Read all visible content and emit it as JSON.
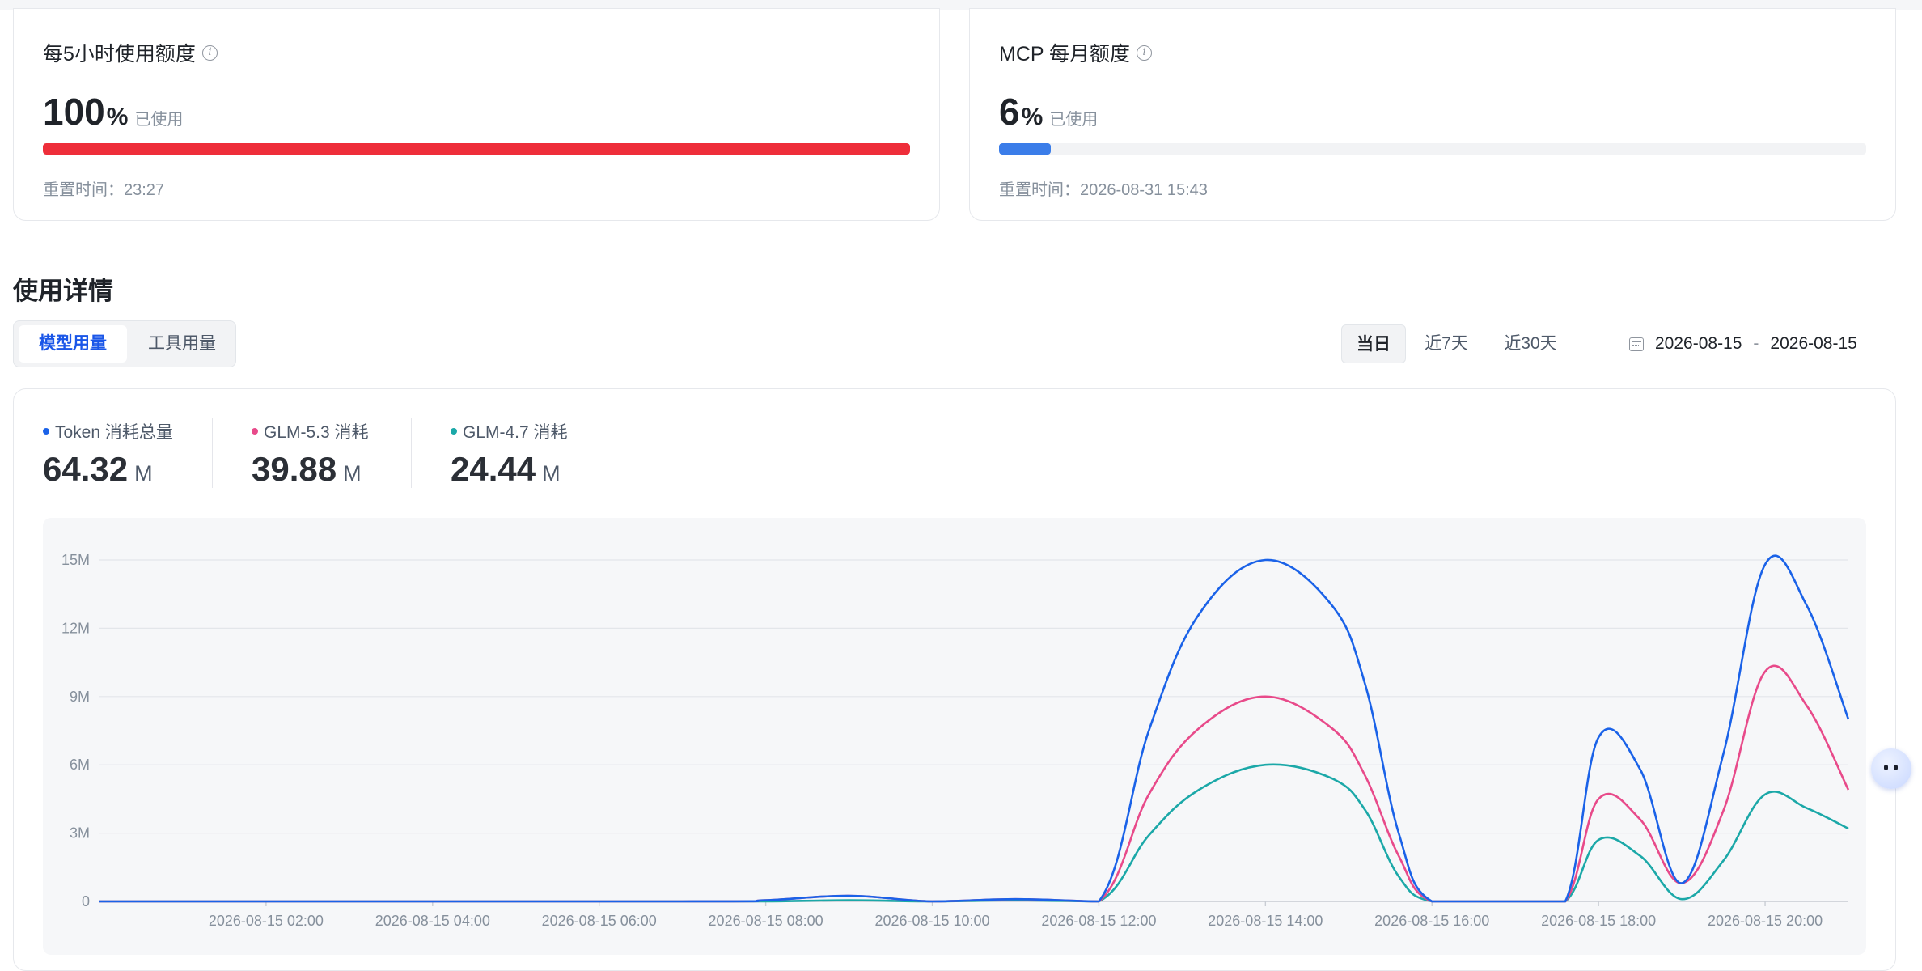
{
  "quota_cards": [
    {
      "title": "每5小时使用额度",
      "value": "100",
      "unit": "%",
      "used_label": "已使用",
      "reset": "重置时间：23:27",
      "percent": 100,
      "color": "#ee2e3a"
    },
    {
      "title": "MCP 每月额度",
      "value": "6",
      "unit": "%",
      "used_label": "已使用",
      "reset": "重置时间：2026-08-31 15:43",
      "percent": 6,
      "color": "#3b7de9"
    }
  ],
  "section_title": "使用详情",
  "tabs": {
    "model": "模型用量",
    "tool": "工具用量"
  },
  "range": {
    "today": "当日",
    "last7": "近7天",
    "last30": "近30天"
  },
  "date_range": {
    "start": "2026-08-15",
    "sep": "-",
    "end": "2026-08-15"
  },
  "stats": [
    {
      "label": "Token 消耗总量",
      "value": "64.32",
      "unit": "M",
      "color": "#1a62e8"
    },
    {
      "label": "GLM-5.3 消耗",
      "value": "39.88",
      "unit": "M",
      "color": "#e84a8a"
    },
    {
      "label": "GLM-4.7 消耗",
      "value": "24.44",
      "unit": "M",
      "color": "#1ba8a8"
    }
  ],
  "chart_data": {
    "type": "line",
    "x_unit": "hours since 2026-08-15 00:00",
    "x_start": 1.0,
    "x_end": 22.0,
    "ylim": [
      0,
      15
    ],
    "y_ticks": [
      {
        "v": 0,
        "label": "0"
      },
      {
        "v": 3,
        "label": "3M"
      },
      {
        "v": 6,
        "label": "6M"
      },
      {
        "v": 9,
        "label": "9M"
      },
      {
        "v": 12,
        "label": "12M"
      },
      {
        "v": 15,
        "label": "15M"
      }
    ],
    "x_ticks": [
      {
        "v": 3,
        "label": "2026-08-15 02:00"
      },
      {
        "v": 5,
        "label": "2026-08-15 04:00"
      },
      {
        "v": 7,
        "label": "2026-08-15 06:00"
      },
      {
        "v": 9,
        "label": "2026-08-15 08:00"
      },
      {
        "v": 11,
        "label": "2026-08-15 10:00"
      },
      {
        "v": 13,
        "label": "2026-08-15 12:00"
      },
      {
        "v": 15,
        "label": "2026-08-15 14:00"
      },
      {
        "v": 17,
        "label": "2026-08-15 16:00"
      },
      {
        "v": 19,
        "label": "2026-08-15 18:00"
      },
      {
        "v": 21,
        "label": "2026-08-15 20:00"
      }
    ],
    "grid": true,
    "series": [
      {
        "name": "Token 消耗总量",
        "color": "#1a62e8",
        "points": [
          [
            1,
            0
          ],
          [
            8,
            0
          ],
          [
            9,
            0.05
          ],
          [
            10,
            0.25
          ],
          [
            11,
            0
          ],
          [
            12,
            0.1
          ],
          [
            13,
            0
          ],
          [
            13.6,
            7.5
          ],
          [
            14.2,
            12.6
          ],
          [
            15,
            15
          ],
          [
            15.8,
            13
          ],
          [
            16.2,
            9.5
          ],
          [
            16.6,
            3
          ],
          [
            17,
            0
          ],
          [
            18,
            0
          ],
          [
            18.6,
            0
          ],
          [
            19,
            7.2
          ],
          [
            19.5,
            5.8
          ],
          [
            20,
            0.8
          ],
          [
            20.5,
            6.5
          ],
          [
            21,
            14.8
          ],
          [
            21.5,
            13
          ],
          [
            22,
            8
          ]
        ]
      },
      {
        "name": "GLM-5.3 消耗",
        "color": "#e84a8a",
        "points": [
          [
            1,
            0
          ],
          [
            8,
            0
          ],
          [
            9,
            0.05
          ],
          [
            10,
            0.25
          ],
          [
            11,
            0
          ],
          [
            12,
            0.1
          ],
          [
            13,
            0
          ],
          [
            13.6,
            4.7
          ],
          [
            14.2,
            7.6
          ],
          [
            15,
            9
          ],
          [
            15.8,
            7.6
          ],
          [
            16.2,
            5.5
          ],
          [
            16.6,
            2.0
          ],
          [
            17,
            0
          ],
          [
            18,
            0
          ],
          [
            18.6,
            0
          ],
          [
            19,
            4.5
          ],
          [
            19.5,
            3.6
          ],
          [
            20,
            0.8
          ],
          [
            20.5,
            4.0
          ],
          [
            21,
            10.1
          ],
          [
            21.5,
            8.6
          ],
          [
            22,
            4.9
          ]
        ]
      },
      {
        "name": "GLM-4.7 消耗",
        "color": "#1ba8a8",
        "points": [
          [
            1,
            0
          ],
          [
            8,
            0
          ],
          [
            9,
            0.0
          ],
          [
            10,
            0.05
          ],
          [
            11,
            0
          ],
          [
            12,
            0.05
          ],
          [
            13,
            0
          ],
          [
            13.6,
            2.9
          ],
          [
            14.2,
            4.9
          ],
          [
            15,
            6
          ],
          [
            15.8,
            5.4
          ],
          [
            16.2,
            4.0
          ],
          [
            16.6,
            1.1
          ],
          [
            17,
            0
          ],
          [
            18,
            0
          ],
          [
            18.6,
            0
          ],
          [
            19,
            2.7
          ],
          [
            19.5,
            2.0
          ],
          [
            20,
            0.1
          ],
          [
            20.5,
            1.8
          ],
          [
            21,
            4.7
          ],
          [
            21.5,
            4.1
          ],
          [
            22,
            3.2
          ]
        ]
      }
    ]
  }
}
